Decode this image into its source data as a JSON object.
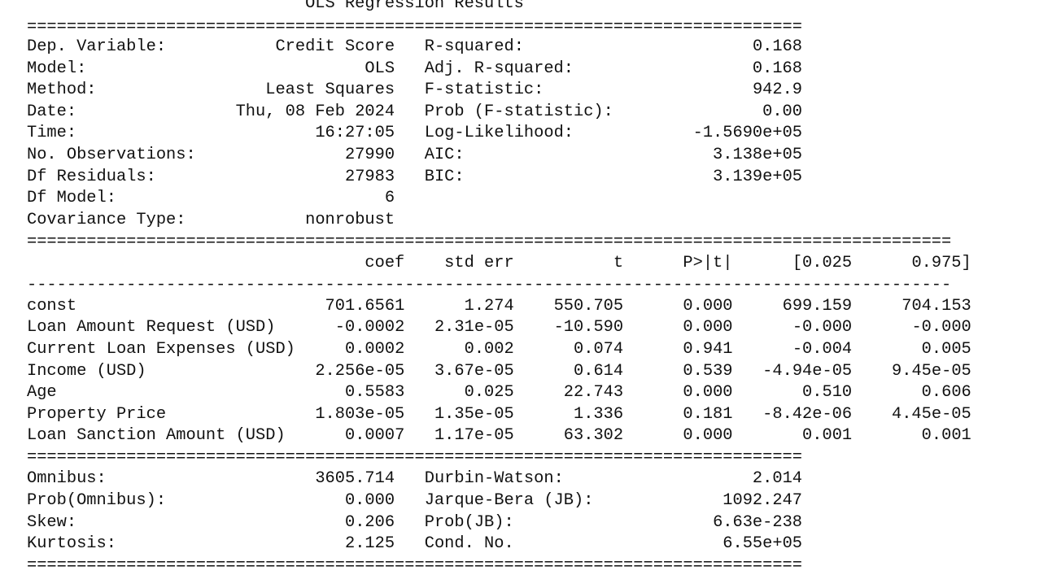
{
  "summary": {
    "title": "OLS Regression Results",
    "rule_top": "==============================================================================",
    "info": [
      {
        "left_label": "Dep. Variable:",
        "left_value": "Credit Score",
        "right_label": "R-squared:",
        "right_value": "0.168"
      },
      {
        "left_label": "Model:",
        "left_value": "OLS",
        "right_label": "Adj. R-squared:",
        "right_value": "0.168"
      },
      {
        "left_label": "Method:",
        "left_value": "Least Squares",
        "right_label": "F-statistic:",
        "right_value": "942.9"
      },
      {
        "left_label": "Date:",
        "left_value": "Thu, 08 Feb 2024",
        "right_label": "Prob (F-statistic):",
        "right_value": "0.00"
      },
      {
        "left_label": "Time:",
        "left_value": "16:27:05",
        "right_label": "Log-Likelihood:",
        "right_value": "-1.5690e+05"
      },
      {
        "left_label": "No. Observations:",
        "left_value": "27990",
        "right_label": "AIC:",
        "right_value": "3.138e+05"
      },
      {
        "left_label": "Df Residuals:",
        "left_value": "27983",
        "right_label": "BIC:",
        "right_value": "3.139e+05"
      },
      {
        "left_label": "Df Model:",
        "left_value": "6",
        "right_label": "",
        "right_value": ""
      },
      {
        "left_label": "Covariance Type:",
        "left_value": "nonrobust",
        "right_label": "",
        "right_value": ""
      }
    ],
    "rule_wide": "=============================================================================================",
    "coef_header": [
      "",
      "coef",
      "std err",
      "t",
      "P>|t|",
      "[0.025",
      "0.975]"
    ],
    "rule_dash": "---------------------------------------------------------------------------------------------",
    "coefficients": [
      [
        "const",
        "701.6561",
        "1.274",
        "550.705",
        "0.000",
        "699.159",
        "704.153"
      ],
      [
        "Loan Amount Request (USD)",
        "-0.0002",
        "2.31e-05",
        "-10.590",
        "0.000",
        "-0.000",
        "-0.000"
      ],
      [
        "Current Loan Expenses (USD)",
        "0.0002",
        "0.002",
        "0.074",
        "0.941",
        "-0.004",
        "0.005"
      ],
      [
        "Income (USD)",
        "2.256e-05",
        "3.67e-05",
        "0.614",
        "0.539",
        "-4.94e-05",
        "9.45e-05"
      ],
      [
        "Age",
        "0.5583",
        "0.025",
        "22.743",
        "0.000",
        "0.510",
        "0.606"
      ],
      [
        "Property Price",
        "1.803e-05",
        "1.35e-05",
        "1.336",
        "0.181",
        "-8.42e-06",
        "4.45e-05"
      ],
      [
        "Loan Sanction Amount (USD)",
        "0.0007",
        "1.17e-05",
        "63.302",
        "0.000",
        "0.001",
        "0.001"
      ]
    ],
    "rule_mid": "==============================================================================",
    "diagnostics": [
      {
        "left_label": "Omnibus:",
        "left_value": "3605.714",
        "right_label": "Durbin-Watson:",
        "right_value": "2.014"
      },
      {
        "left_label": "Prob(Omnibus):",
        "left_value": "0.000",
        "right_label": "Jarque-Bera (JB):",
        "right_value": "1092.247"
      },
      {
        "left_label": "Skew:",
        "left_value": "0.206",
        "right_label": "Prob(JB):",
        "right_value": "6.63e-238"
      },
      {
        "left_label": "Kurtosis:",
        "left_value": "2.125",
        "right_label": "Cond. No.",
        "right_value": "6.55e+05"
      }
    ],
    "rule_bottom": "=============================================================================="
  }
}
